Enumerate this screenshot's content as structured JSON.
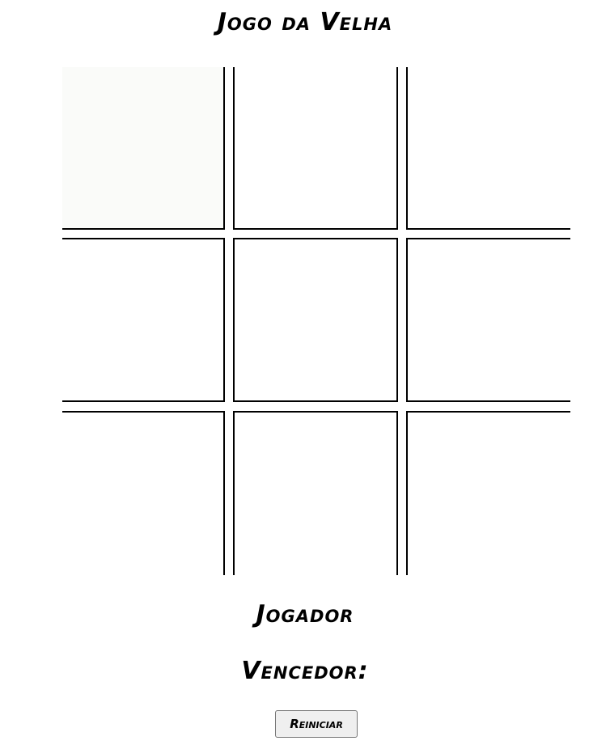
{
  "game": {
    "title": "Jogo da Velha",
    "player_label": "Jogador",
    "winner_label": "Vencedor:",
    "restart_label": "Reiniciar",
    "cells": [
      "",
      "",
      "",
      "",
      "",
      "",
      "",
      "",
      ""
    ]
  }
}
